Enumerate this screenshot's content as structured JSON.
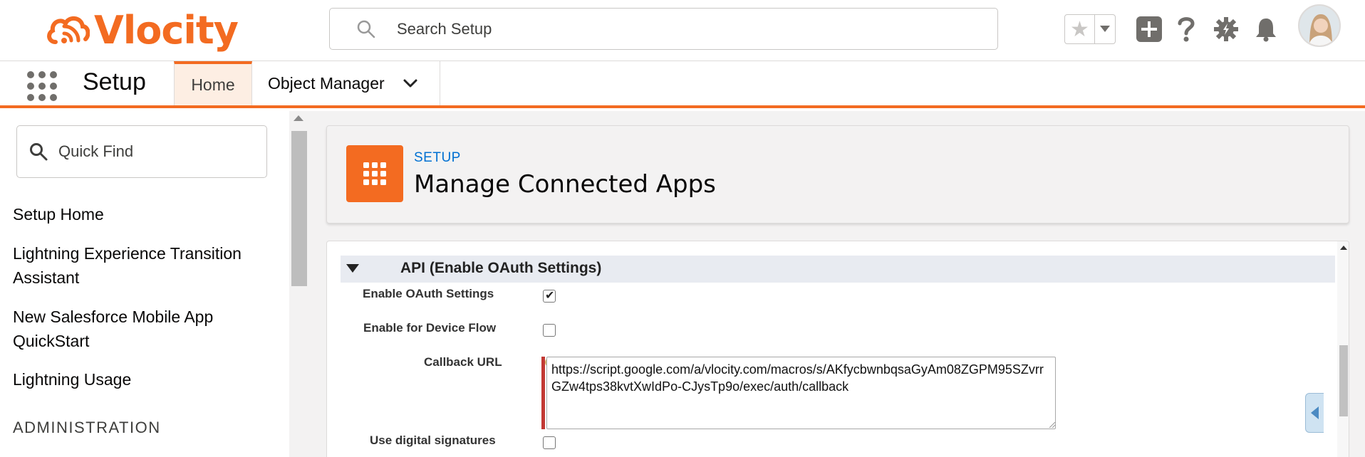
{
  "header": {
    "logo_text": "Vlocity",
    "search_placeholder": "Search Setup"
  },
  "nav": {
    "app_name": "Setup",
    "tabs": [
      {
        "label": "Home",
        "active": true
      },
      {
        "label": "Object Manager",
        "active": false
      }
    ]
  },
  "sidebar": {
    "quick_find_placeholder": "Quick Find",
    "items": [
      "Setup Home",
      "Lightning Experience Transition Assistant",
      "New Salesforce Mobile App QuickStart",
      "Lightning Usage"
    ],
    "section_heading": "ADMINISTRATION"
  },
  "page_header": {
    "eyebrow": "SETUP",
    "title": "Manage Connected Apps"
  },
  "section": {
    "title": "API (Enable OAuth Settings)",
    "fields": {
      "enable_oauth": {
        "label": "Enable OAuth Settings",
        "checked": true
      },
      "device_flow": {
        "label": "Enable for Device Flow",
        "checked": false
      },
      "callback_url": {
        "label": "Callback URL",
        "value": "https://script.google.com/a/vlocity.com/macros/s/AKfycbwnbqsaGyAm08ZGPM95SZvrrGZw4tps38kvtXwIdPo-CJysTp9o/exec/auth/callback"
      },
      "digital_signatures": {
        "label": "Use digital signatures",
        "checked": false
      }
    }
  },
  "colors": {
    "brand_orange": "#f36b21",
    "link_blue": "#0070d2",
    "required_red": "#c23934"
  }
}
